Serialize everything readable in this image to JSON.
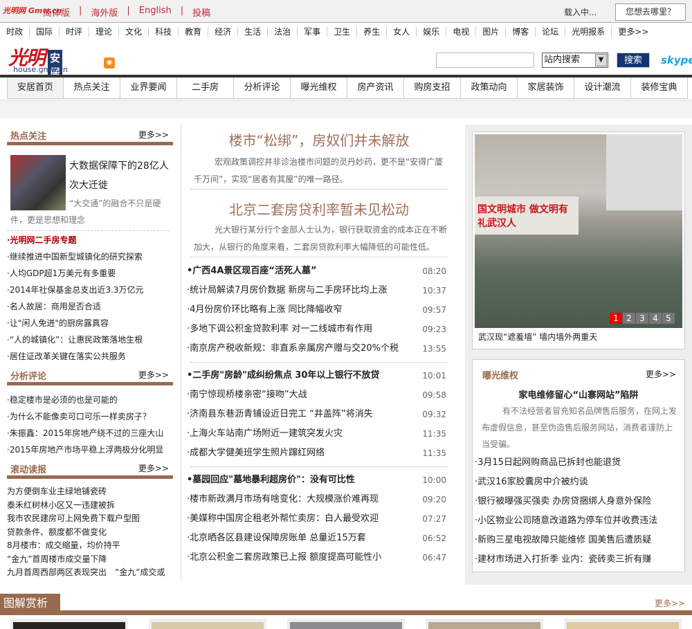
{
  "top": {
    "logo": "光明网 Gmw.cn",
    "links": [
      "简体版",
      "海外版",
      "English",
      "投稿"
    ],
    "loading": "载入中...",
    "where": "您想去哪里？"
  },
  "channels": [
    "时政",
    "国际",
    "时评",
    "理论",
    "文化",
    "科技",
    "教育",
    "经济",
    "生活",
    "法治",
    "军事",
    "卫生",
    "养生",
    "女人",
    "娱乐",
    "电视",
    "图片",
    "博客",
    "论坛",
    "光明报系",
    "更多>>"
  ],
  "logo": {
    "brush": "光明",
    "anju": "安居",
    "url": "house.gmw.cn"
  },
  "search": {
    "placeholder": "",
    "select": "站内搜索",
    "button": "搜索",
    "skype": "skype"
  },
  "nav": [
    "安居首页",
    "热点关注",
    "业界要闻",
    "二手房",
    "分析评论",
    "曝光维权",
    "房产资讯",
    "购房支招",
    "政策动向",
    "家居装饰",
    "设计潮流",
    "装修宝典"
  ],
  "left": {
    "hot": {
      "title": "热点关注",
      "more": "更多>>",
      "feature_title": "大数据保障下的28亿人次大迁徙",
      "feature_desc": "“大交通”的融合不只是硬件，更是思想和理念",
      "items": [
        "·光明网二手房专题",
        "·继续推进中国新型城镇化的研究探索",
        "·人均GDP超1万美元有多重要",
        "·2014年社保基金总支出近3.3万亿元",
        "·名人故居：商用是否合适",
        "·让\"闲人免进\"的厨房露真容",
        "·“人的城镇化”：让惠民政策落地生根",
        "·居住证改革关键在落实公共服务"
      ]
    },
    "analysis": {
      "title": "分析评论",
      "more": "更多>>",
      "items": [
        "·稳定楼市是必须的也是可能的",
        "·为什么不能像卖可口可乐一样卖房子？",
        "·朱振鑫：2015年房地产绕不过的三座大山",
        "·2015年房地产市场平稳上浮两极分化明显"
      ]
    },
    "scroll": {
      "title": "滚动读报",
      "more": "更多>>",
      "items": [
        "为方便倒车业主绿地铺瓷砖",
        "泰禾红树林小区又一违建被拆",
        "我市农民建房可上网免费下载户型图",
        "贷款条件、额度都不做变化",
        "8月楼市：成交缩量，均价持平",
        "“金九”首周楼市成交量下降",
        "九月首周西部两区表现突出　“金九”成交或"
      ]
    }
  },
  "center": {
    "headline1": "楼市“松绑”，房奴们并未解放",
    "summary1": "宏观政策调控并非诊治楼市问题的灵丹妙药，更不是“安得广厦千万间”，实现“居者有其屋”的唯一路径。",
    "headline2": "北京二套房贷利率暂未见松动",
    "summary2": "光大银行某分行个金部人士认为，银行获取资金的成本正在不断加大，从银行的角度来看，二套房贷款利率大幅降低的可能性低。",
    "groups": [
      [
        {
          "t": "•广西4A景区现百座“活死人墓”",
          "time": "08:20",
          "bold": true
        },
        {
          "t": "·统计局解读7月房价数据 新房与二手房环比均上涨",
          "time": "10:37"
        },
        {
          "t": "·4月份房价环比略有上涨 同比降幅收窄",
          "time": "09:57"
        },
        {
          "t": "·多地下调公积金贷款利率 对一二线城市有作用",
          "time": "09:23"
        },
        {
          "t": "·南京房产税收新规：非直系亲属房产赠与交20%个税",
          "time": "13:55"
        }
      ],
      [
        {
          "t": "•二手房\"房龄\"成纠纷焦点 30年以上银行不放贷",
          "time": "10:01",
          "bold": true
        },
        {
          "t": "·南宁惊现桥楼亲密“接吻”大战",
          "time": "09:58"
        },
        {
          "t": "·济南县东巷沥青铺设近日完工 “井盖阵”将消失",
          "time": "09:32"
        },
        {
          "t": "·上海火车站南广场附近一建筑突发火灾",
          "time": "11:35"
        },
        {
          "t": "·成都大学健美班学生照片蹿红网络",
          "time": "11:35"
        }
      ],
      [
        {
          "t": "•墓园回应\"墓地暴利超房价\"：没有可比性",
          "time": "10:00",
          "bold": true
        },
        {
          "t": "·楼市新政满月市场有啥变化：大规模涨价难再现",
          "time": "09:20"
        },
        {
          "t": "·美媒称中国房企租老外帮忙卖房：白人最受欢迎",
          "time": "07:27"
        },
        {
          "t": "·北京晒各区县建设保障房账单 总量近15万套",
          "time": "06:52"
        },
        {
          "t": "·北京公积金二套房政策已上报 额度提高可能性小",
          "time": "06:47"
        }
      ]
    ]
  },
  "right": {
    "photo_banner": "国文明城市 做文明有礼武汉人",
    "pager": [
      "1",
      "2",
      "3",
      "4",
      "5"
    ],
    "pager_active": 1,
    "caption": "武汉现“遮羞墙” 墙内墙外两重天",
    "expose": {
      "title": "曝光维权",
      "more": "更多>>",
      "headline": "家电维修留心“山寨网站”陷阱",
      "summary": "有不法经营者冒充知名品牌售后服务，在网上发布虚假信息，甚至伪造售后服务网站，消费者谨防上当受骗。",
      "items": [
        "·3月15日起网购商品已拆封也能退货",
        "·武汉16家胶囊房中介被约谈",
        "·银行被曝强买强卖 办房贷捆绑人身意外保险",
        "·小区物业公司随意改道路为停车位并收费违法",
        "·新购三星电视故障只能维修 国美售后遭质疑",
        "·建材市场进入打折季 业内：瓷砖卖三折有赚"
      ]
    }
  },
  "gallery": {
    "title": "图解赏析",
    "more": "更多>>"
  },
  "colors": {
    "brown": "#9a6a4f",
    "red": "#c0283a",
    "navy": "#133472"
  }
}
